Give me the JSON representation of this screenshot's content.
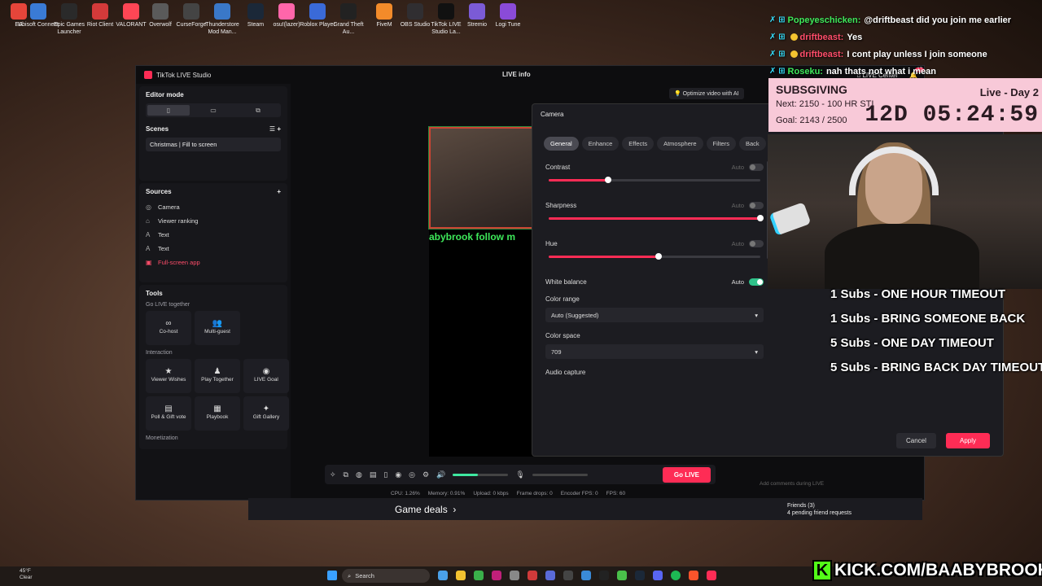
{
  "desktop_icons": [
    {
      "label": "EA",
      "icon": "ea-icon",
      "color": "#e6453a"
    },
    {
      "label": "Ubisoft Connect",
      "icon": "ubisoft-icon",
      "color": "#3a7bd5"
    },
    {
      "label": "Epic Games Launcher",
      "icon": "epic-icon",
      "color": "#2a2a2a"
    },
    {
      "label": "Riot Client",
      "icon": "riot-icon",
      "color": "#d43a3a"
    },
    {
      "label": "VALORANT",
      "icon": "valorant-icon",
      "color": "#ff4655"
    },
    {
      "label": "Overwolf",
      "icon": "overwolf-icon",
      "color": "#5a5a5a"
    },
    {
      "label": "CurseForge",
      "icon": "curseforge-icon",
      "color": "#444"
    },
    {
      "label": "Thunderstore Mod Man...",
      "icon": "thunderstore-icon",
      "color": "#3a78c8"
    },
    {
      "label": "Steam",
      "icon": "steam-icon",
      "color": "#1b2838"
    },
    {
      "label": "osu!(lazer)",
      "icon": "osu-icon",
      "color": "#ff66aa"
    },
    {
      "label": "Roblox Player",
      "icon": "roblox-icon",
      "color": "#3a6ad8"
    },
    {
      "label": "Grand Theft Au...",
      "icon": "gta-icon",
      "color": "#222"
    },
    {
      "label": "FiveM",
      "icon": "fivem-icon",
      "color": "#f38b2a"
    },
    {
      "label": "OBS Studio",
      "icon": "obs-icon",
      "color": "#302e31"
    },
    {
      "label": "TikTok LIVE Studio La...",
      "icon": "tiktok-icon",
      "color": "#111"
    },
    {
      "label": "Stremio",
      "icon": "stremio-icon",
      "color": "#7b5bd6"
    },
    {
      "label": "Logi Tune",
      "icon": "logitune-icon",
      "color": "#8a4bd8"
    }
  ],
  "app": {
    "title": "TikTok LIVE Studio",
    "live_info": "LIVE info",
    "live_center": "LIVE Center",
    "notif_count": "17",
    "optimize": "Optimize video with AI",
    "editor_mode": "Editor mode",
    "scenes_title": "Scenes",
    "scene_item": "Christmas | Fill to screen",
    "sources_title": "Sources",
    "sources": [
      {
        "label": "Camera",
        "icon": "camera-icon",
        "glyph": "◎"
      },
      {
        "label": "Viewer ranking",
        "icon": "ranking-icon",
        "glyph": "⌂"
      },
      {
        "label": "Text",
        "icon": "text-icon",
        "glyph": "A"
      },
      {
        "label": "Text",
        "icon": "text-icon",
        "glyph": "A"
      },
      {
        "label": "Full-screen app",
        "icon": "app-icon",
        "glyph": "▣"
      }
    ],
    "tools_title": "Tools",
    "go_live_together": "Go LIVE together",
    "together_tools": [
      {
        "label": "Co-host",
        "glyph": "∞"
      },
      {
        "label": "Multi-guest",
        "glyph": "👥"
      }
    ],
    "interaction": "Interaction",
    "interaction_tools": [
      {
        "label": "Viewer Wishes",
        "glyph": "★"
      },
      {
        "label": "Play Together",
        "glyph": "♟"
      },
      {
        "label": "LIVE Goal",
        "glyph": "◉"
      },
      {
        "label": "Poll & Gift vote",
        "glyph": "▤"
      },
      {
        "label": "Playbook",
        "glyph": "▦"
      },
      {
        "label": "Gift Gallery",
        "glyph": "✦"
      }
    ],
    "monetization": "Monetization",
    "preview_text": "abybrook   follow m",
    "go_live": "Go LIVE",
    "volume_level": 0.45,
    "stats": {
      "cpu": "CPU: 1.26%",
      "memory": "Memory: 0.91%",
      "upload": "Upload: 0 kbps",
      "drops": "Frame drops: 0",
      "encoder": "Encoder FPS: 0",
      "fps": "FPS: 60"
    },
    "comment_placeholder": "Add comments during LIVE"
  },
  "camera_dialog": {
    "title": "Camera",
    "tabs": [
      "General",
      "Enhance",
      "Effects",
      "Atmosphere",
      "Filters",
      "Back"
    ],
    "auto_label": "Auto",
    "contrast": {
      "label": "Contrast",
      "value": 0.28,
      "auto": false
    },
    "sharpness": {
      "label": "Sharpness",
      "value": 1.0,
      "auto": false
    },
    "hue": {
      "label": "Hue",
      "value": 0.52,
      "auto": false
    },
    "white_balance": {
      "label": "White balance",
      "auto": true
    },
    "color_range": {
      "label": "Color range",
      "value": "Auto (Suggested)"
    },
    "color_space": {
      "label": "Color space",
      "value": "709"
    },
    "audio_capture": "Audio capture",
    "cancel": "Cancel",
    "apply": "Apply"
  },
  "chat": [
    {
      "user": "Popeyeschicken:",
      "message": "@driftbeast did you join me earlier",
      "color": "#3ee85a",
      "sub": false
    },
    {
      "user": "driftbeast:",
      "message": "Yes",
      "color": "#ff4d6a",
      "sub": true
    },
    {
      "user": "driftbeast:",
      "message": "I cont play unless I join someone",
      "color": "#ff4d6a",
      "sub": true
    },
    {
      "user": "Roseku:",
      "message": "nah thats not what i mean",
      "color": "#3ee85a",
      "sub": false
    }
  ],
  "subs_banner": {
    "title": "SUBSGIVING",
    "next": "Next: 2150 - 100 HR STI",
    "goal": "Goal: 2143 / 2500",
    "day": "Live - Day 2",
    "timer": "12D 05:24:59"
  },
  "rules": [
    "1 Subs - ONE HOUR TIMEOUT",
    "1 Subs - BRING SOMEONE BACK",
    "5 Subs - ONE DAY TIMEOUT",
    "5 Subs - BRING BACK DAY TIMEOUT"
  ],
  "steam_strip": {
    "game_deals": "Game deals",
    "friends": "Friends (3)",
    "friend_requests": "4 pending friend requests"
  },
  "taskbar": {
    "temp": "45°F",
    "weather": "Clear",
    "search": "Search"
  },
  "kick": "KICK.COM/BAABYBROOK"
}
